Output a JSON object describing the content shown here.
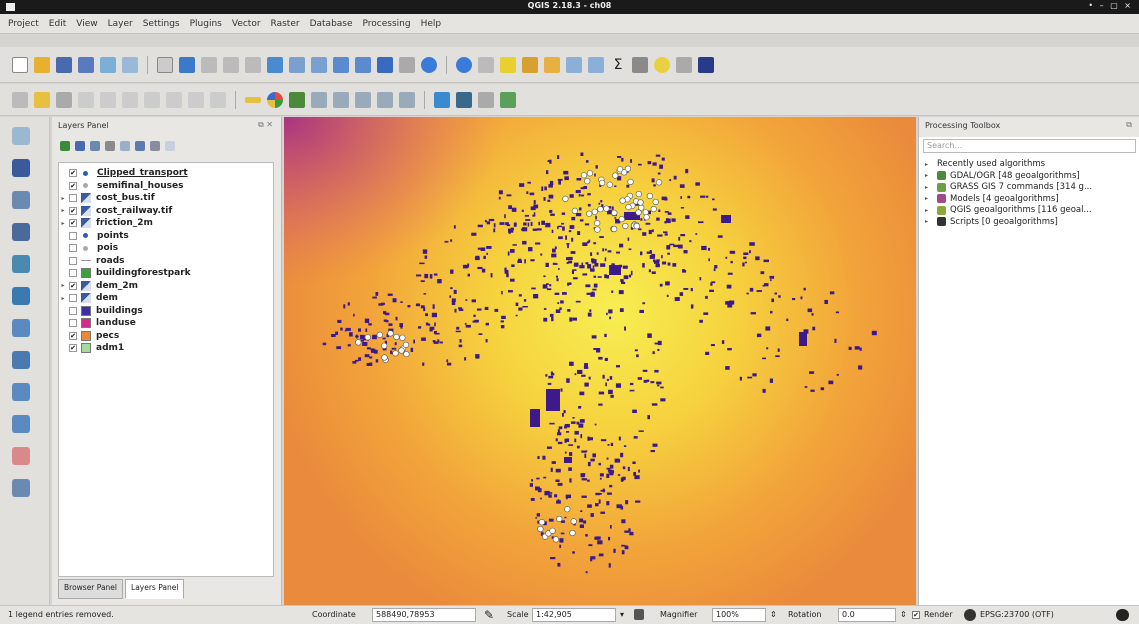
{
  "window": {
    "title": "QGIS 2.18.3 - ch08",
    "controls": "• – ▢ ×"
  },
  "menu": [
    "Project",
    "Edit",
    "View",
    "Layer",
    "Settings",
    "Plugins",
    "Vector",
    "Raster",
    "Database",
    "Processing",
    "Help"
  ],
  "layers_panel": {
    "title": "Layers Panel",
    "layers": [
      {
        "name": "Clipped_transport",
        "checked": true,
        "expandable": false,
        "icon": "point-icon",
        "color": "#2d5fb0"
      },
      {
        "name": "semifinal_houses",
        "checked": true,
        "expandable": false,
        "icon": "point-icon",
        "color": "#aaaaaa"
      },
      {
        "name": "cost_bus.tif",
        "checked": false,
        "expandable": true,
        "icon": "raster-icon",
        "color": "#3a5a9a"
      },
      {
        "name": "cost_railway.tif",
        "checked": true,
        "expandable": true,
        "icon": "raster-icon",
        "color": "#3a5a9a"
      },
      {
        "name": "friction_2m",
        "checked": true,
        "expandable": true,
        "icon": "raster-icon",
        "color": "#3a5a9a"
      },
      {
        "name": "points",
        "checked": false,
        "expandable": false,
        "icon": "point-icon",
        "color": "#2d5fb0"
      },
      {
        "name": "pois",
        "checked": false,
        "expandable": false,
        "icon": "point-icon",
        "color": "#aaaaaa"
      },
      {
        "name": "roads",
        "checked": false,
        "expandable": false,
        "icon": "line-icon",
        "color": "#999999"
      },
      {
        "name": "buildingforestpark",
        "checked": false,
        "expandable": false,
        "icon": "polygon-icon",
        "color": "#3aa03a"
      },
      {
        "name": "dem_2m",
        "checked": true,
        "expandable": true,
        "icon": "raster-icon",
        "color": "#3a5a9a"
      },
      {
        "name": "dem",
        "checked": false,
        "expandable": true,
        "icon": "raster-icon",
        "color": "#3a5a9a"
      },
      {
        "name": "buildings",
        "checked": false,
        "expandable": false,
        "icon": "polygon-icon",
        "color": "#3d2ea8"
      },
      {
        "name": "landuse",
        "checked": false,
        "expandable": false,
        "icon": "polygon-icon",
        "color": "#d62a8a"
      },
      {
        "name": "pecs",
        "checked": true,
        "expandable": false,
        "icon": "polygon-icon",
        "color": "#e88a3a"
      },
      {
        "name": "adm1",
        "checked": true,
        "expandable": false,
        "icon": "polygon-icon",
        "color": "#a7d8a0"
      }
    ],
    "tabs": [
      "Browser Panel",
      "Layers Panel"
    ]
  },
  "toolbox": {
    "title": "Processing Toolbox",
    "search_placeholder": "Search...",
    "items": [
      {
        "label": "Recently used algorithms",
        "icon": "none",
        "color": "#ffffff"
      },
      {
        "label": "GDAL/OGR [48 geoalgorithms]",
        "icon": "gdal-icon",
        "color": "#4a8a3a"
      },
      {
        "label": "GRASS GIS 7 commands [314 g...",
        "icon": "grass-icon",
        "color": "#6aa04a"
      },
      {
        "label": "Models [4 geoalgorithms]",
        "icon": "models-icon",
        "color": "#a04a8a"
      },
      {
        "label": "QGIS geoalgorithms [116 geoal...",
        "icon": "qgis-icon",
        "color": "#8aa83a"
      },
      {
        "label": "Scripts [0 geoalgorithms]",
        "icon": "scripts-icon",
        "color": "#333333"
      }
    ]
  },
  "status": {
    "message": "1 legend entries removed.",
    "coordinate_label": "Coordinate",
    "coordinate": "588490,78953",
    "scale_label": "Scale",
    "scale": "1:42,905",
    "magnifier_label": "Magnifier",
    "magnifier": "100%",
    "rotation_label": "Rotation",
    "rotation": "0.0",
    "render_label": "Render",
    "crs": "EPSG:23700 (OTF)"
  },
  "colors": {
    "building": "#3d1a8a",
    "poi": "#ffffff"
  }
}
